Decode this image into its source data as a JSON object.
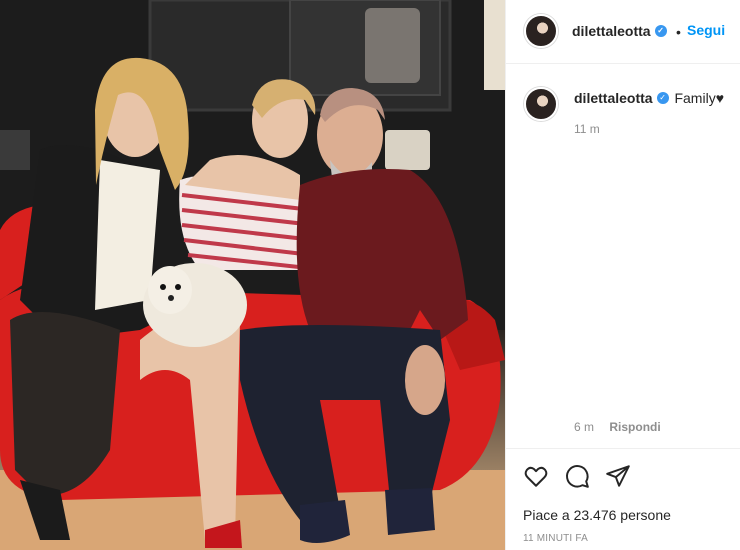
{
  "post": {
    "username": "dilettaleotta",
    "verified_icon": "verified-badge-icon",
    "separator": "•",
    "follow_label": "Segui",
    "caption": "Family♥",
    "caption_time": "11 m",
    "comment_time": "6 m",
    "reply_label": "Rispondi",
    "likes_text": "Piace a 23.476 persone",
    "posted_ago": "11 MINUTI FA"
  },
  "icons": {
    "like": "heart-icon",
    "comment": "comment-bubble-icon",
    "share": "send-paper-plane-icon"
  },
  "colors": {
    "accent": "#0095f6",
    "verified": "#3897f0",
    "muted": "#8e8e8e",
    "text": "#262626",
    "sofa": "#d8201e"
  }
}
